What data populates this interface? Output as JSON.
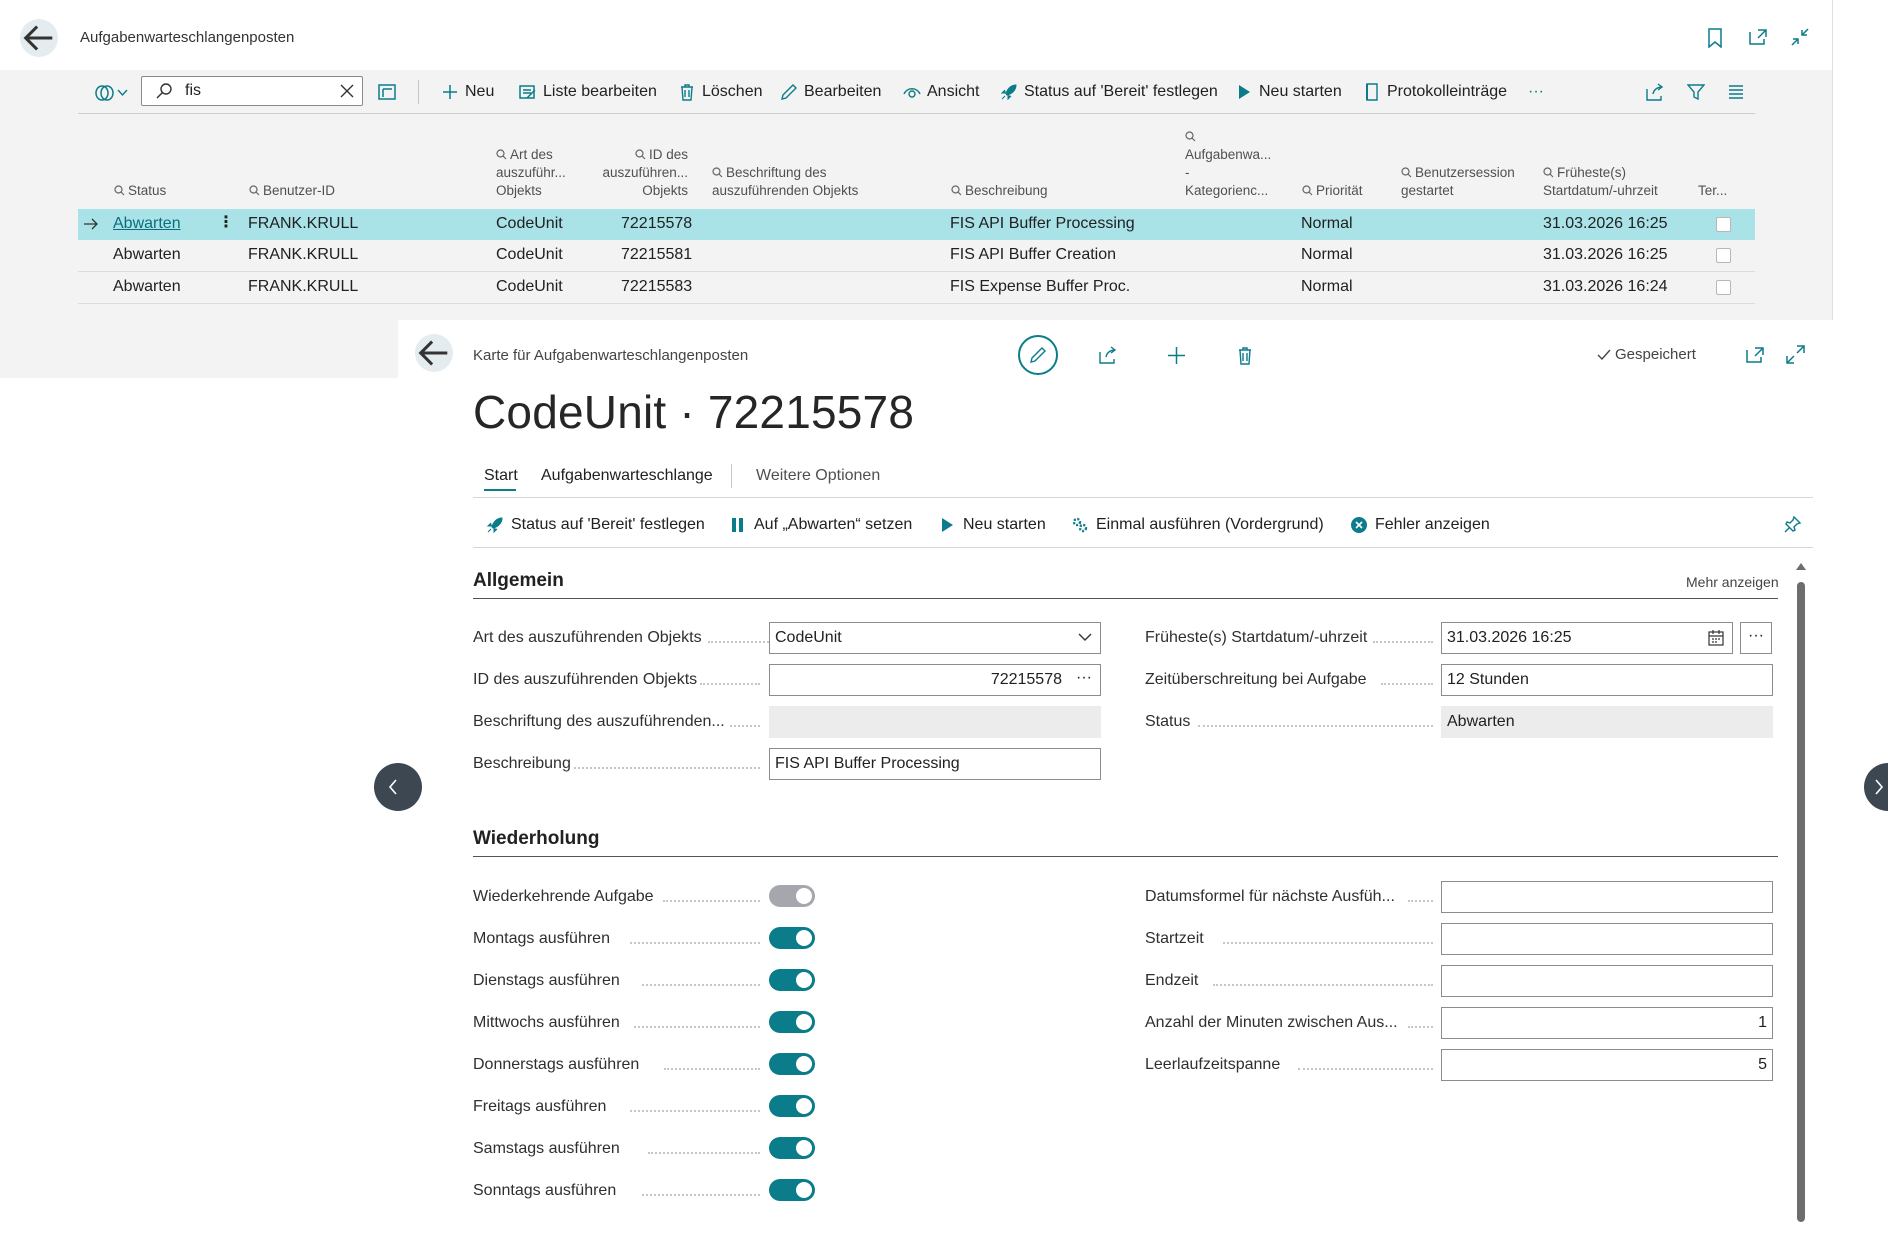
{
  "list_page": {
    "title": "Aufgabenwarteschlangenposten",
    "search_value": "fis",
    "toolbar": {
      "new": "Neu",
      "edit_list": "Liste bearbeiten",
      "delete": "Löschen",
      "edit": "Bearbeiten",
      "view": "Ansicht",
      "set_ready": "Status auf 'Bereit' festlegen",
      "restart": "Neu starten",
      "log_entries": "Protokolleinträge",
      "more": "···"
    },
    "columns": {
      "status": "Status",
      "user_id": "Benutzer-ID",
      "object_type_1": "Art des",
      "object_type_2": "auszuführ...",
      "object_type_3": "Objekts",
      "object_id_1": "ID des",
      "object_id_2": "auszuführen...",
      "object_id_3": "Objekts",
      "caption_1": "Beschriftung des",
      "caption_2": "auszuführenden Objekts",
      "description": "Beschreibung",
      "category_1": "Aufgabenwa...",
      "category_2": "-",
      "category_3": "Kategorienc...",
      "priority": "Priorität",
      "session_1": "Benutzersession",
      "session_2": "gestartet",
      "start_1": "Früheste(s)",
      "start_2": "Startdatum/-uhrzeit",
      "ter": "Ter..."
    },
    "rows": [
      {
        "status": "Abwarten",
        "user": "FRANK.KRULL",
        "type": "CodeUnit",
        "id": "72215578",
        "description": "FIS API Buffer Processing",
        "priority": "Normal",
        "start": "31.03.2026 16:25"
      },
      {
        "status": "Abwarten",
        "user": "FRANK.KRULL",
        "type": "CodeUnit",
        "id": "72215581",
        "description": "FIS API Buffer Creation",
        "priority": "Normal",
        "start": "31.03.2026 16:25"
      },
      {
        "status": "Abwarten",
        "user": "FRANK.KRULL",
        "type": "CodeUnit",
        "id": "72215583",
        "description": "FIS Expense Buffer Proc.",
        "priority": "Normal",
        "start": "31.03.2026 16:24"
      }
    ]
  },
  "card": {
    "breadcrumb": "Karte für Aufgabenwarteschlangenposten",
    "saved": "Gespeichert",
    "title": "CodeUnit · 72215578",
    "tabs": {
      "start": "Start",
      "queue": "Aufgabenwarteschlange",
      "more": "Weitere Optionen"
    },
    "actions": {
      "set_ready": "Status auf 'Bereit' festlegen",
      "set_waiting": "Auf „Abwarten“ setzen",
      "restart": "Neu starten",
      "run_once": "Einmal ausführen (Vordergrund)",
      "show_error": "Fehler anzeigen"
    },
    "general": {
      "title": "Allgemein",
      "show_more": "Mehr anzeigen",
      "object_type_label": "Art des auszuführenden Objekts",
      "object_type_value": "CodeUnit",
      "object_id_label": "ID des auszuführenden Objekts",
      "object_id_value": "72215578",
      "object_caption_label": "Beschriftung des auszuführenden...",
      "object_caption_value": "",
      "description_label": "Beschreibung",
      "description_value": "FIS API Buffer Processing",
      "earliest_start_label": "Früheste(s) Startdatum/-uhrzeit",
      "earliest_start_value": "31.03.2026 16:25",
      "timeout_label": "Zeitüberschreitung bei Aufgabe",
      "timeout_value": "12 Stunden",
      "status_label": "Status",
      "status_value": "Abwarten"
    },
    "recurrence": {
      "title": "Wiederholung",
      "recurring_label": "Wiederkehrende Aufgabe",
      "recurring_value": false,
      "days": [
        {
          "label": "Montags ausführen",
          "value": true
        },
        {
          "label": "Dienstags ausführen",
          "value": true
        },
        {
          "label": "Mittwochs ausführen",
          "value": true
        },
        {
          "label": "Donnerstags ausführen",
          "value": true
        },
        {
          "label": "Freitags ausführen",
          "value": true
        },
        {
          "label": "Samstags ausführen",
          "value": true
        },
        {
          "label": "Sonntags ausführen",
          "value": true
        }
      ],
      "date_formula_label": "Datumsformel für nächste Ausfüh...",
      "date_formula_value": "",
      "start_time_label": "Startzeit",
      "start_time_value": "",
      "end_time_label": "Endzeit",
      "end_time_value": "",
      "minutes_between_label": "Anzahl der Minuten zwischen Aus...",
      "minutes_between_value": "1",
      "idle_label": "Leerlaufzeitspanne",
      "idle_value": "5"
    }
  },
  "colors": {
    "accent": "#0b7c8a",
    "selected_row": "#a9e3e8",
    "toggle_off": "#a6a6ad"
  }
}
